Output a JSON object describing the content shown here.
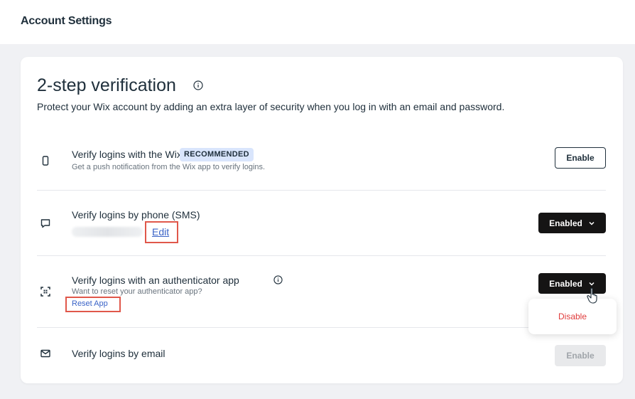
{
  "header": {
    "title": "Account Settings"
  },
  "section": {
    "title": "2-step verification",
    "description": "Protect your Wix account by adding an extra layer of security when you log in with an email and password."
  },
  "methods": [
    {
      "title": "Verify logins with the Wix app",
      "badge": "RECOMMENDED",
      "subtitle": "Get a push notification from the Wix app to verify logins.",
      "button": "Enable",
      "icon": "phone-icon"
    },
    {
      "title": "Verify logins by phone (SMS)",
      "link": "Edit",
      "button": "Enabled",
      "icon": "chat-bubble-icon"
    },
    {
      "title": "Verify logins with an authenticator app",
      "subtitle": "Want to reset your authenticator app?",
      "link": "Reset App",
      "button": "Enabled",
      "icon": "qr-scan-icon"
    },
    {
      "title": "Verify logins by email",
      "button": "Enable",
      "icon": "envelope-icon"
    }
  ],
  "dropdown": {
    "option": "Disable"
  },
  "colors": {
    "accent_link": "#3a63c7",
    "badge_bg": "#d9e5fc",
    "danger": "#e03b3b",
    "highlight": "#e0574a"
  }
}
